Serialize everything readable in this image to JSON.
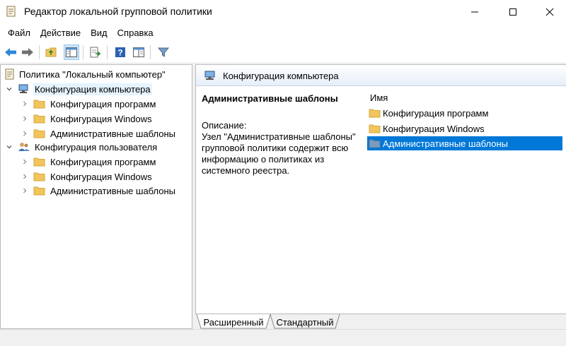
{
  "window": {
    "title": "Редактор локальной групповой политики"
  },
  "menu": {
    "items": [
      "Файл",
      "Действие",
      "Вид",
      "Справка"
    ]
  },
  "toolbar": {
    "buttons": [
      "back-icon",
      "forward-icon",
      "up-folder-icon",
      "show-hide-tree-icon",
      "export-list-icon",
      "help-icon",
      "extended-view-icon",
      "filter-icon"
    ]
  },
  "tree": {
    "root": "Политика \"Локальный компьютер\"",
    "computer": {
      "label": "Конфигурация компьютера",
      "children": [
        "Конфигурация программ",
        "Конфигурация Windows",
        "Административные шаблоны"
      ]
    },
    "user": {
      "label": "Конфигурация пользователя",
      "children": [
        "Конфигурация программ",
        "Конфигурация Windows",
        "Административные шаблоны"
      ]
    }
  },
  "details": {
    "header": "Конфигурация компьютера",
    "selected_title": "Административные шаблоны",
    "description_label": "Описание:",
    "description_text": "Узел \"Административные шаблоны\" групповой политики содержит всю информацию о политиках из системного реестра.",
    "column_name": "Имя",
    "items": [
      "Конфигурация программ",
      "Конфигурация Windows",
      "Административные шаблоны"
    ],
    "selected_index": 2
  },
  "tabs": {
    "extended": "Расширенный",
    "standard": "Стандартный",
    "active": "extended"
  },
  "colors": {
    "selection": "#0078d7",
    "tree_selection": "#e5f3ff",
    "folder": "#f2c55c"
  }
}
